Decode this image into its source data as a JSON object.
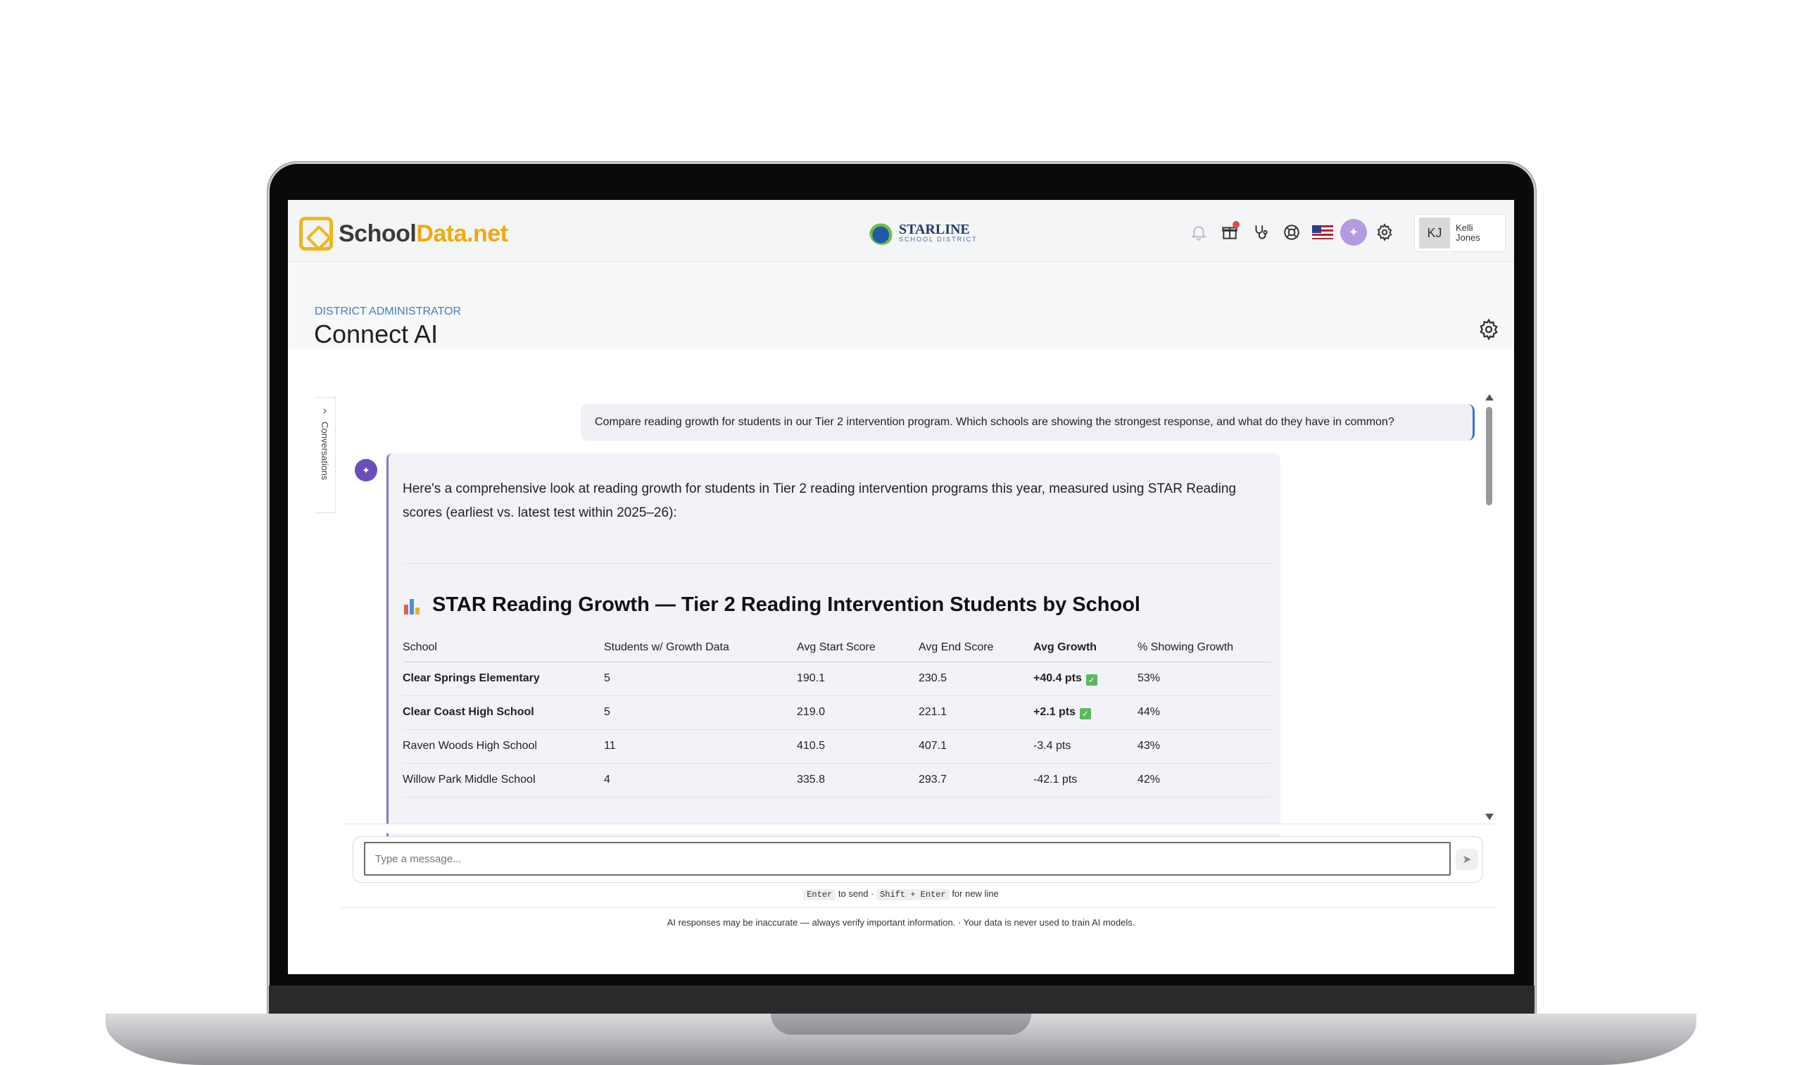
{
  "brand": {
    "name_a": "School",
    "name_b": "Data.net"
  },
  "district": {
    "name": "STARLINE",
    "sub": "SCHOOL DISTRICT"
  },
  "header_icons": [
    "bell-icon",
    "gift-icon",
    "stethoscope-icon",
    "help-lifebuoy-icon",
    "us-flag-icon",
    "ai-sparkle-icon",
    "gear-icon"
  ],
  "user": {
    "initials": "KJ",
    "first": "Kelli",
    "last": "Jones"
  },
  "page": {
    "role": "DISTRICT ADMINISTRATOR",
    "title": "Connect AI"
  },
  "sidebar": {
    "conversations_label": "Conversations"
  },
  "chat": {
    "user_message": "Compare reading growth for students in our Tier 2 intervention program. Which schools are showing the strongest response, and what do they have in common?",
    "ai_intro": "Here's a comprehensive look at reading growth for students in Tier 2 reading intervention programs this year, measured using STAR Reading scores (earliest vs. latest test within 2025–26):",
    "ai_heading": "STAR Reading Growth — Tier 2 Reading Intervention Students by School",
    "table": {
      "headers": [
        "School",
        "Students w/ Growth Data",
        "Avg Start Score",
        "Avg End Score",
        "Avg Growth",
        "% Showing Growth"
      ],
      "rows": [
        {
          "school": "Clear Springs Elementary",
          "students": "5",
          "start": "190.1",
          "end": "230.5",
          "growth": "+40.4 pts",
          "pct": "53%",
          "highlight": true
        },
        {
          "school": "Clear Coast High School",
          "students": "5",
          "start": "219.0",
          "end": "221.1",
          "growth": "+2.1 pts",
          "pct": "44%",
          "highlight": true
        },
        {
          "school": "Raven Woods High School",
          "students": "11",
          "start": "410.5",
          "end": "407.1",
          "growth": "-3.4 pts",
          "pct": "43%",
          "highlight": false
        },
        {
          "school": "Willow Park Middle School",
          "students": "4",
          "start": "335.8",
          "end": "293.7",
          "growth": "-42.1 pts",
          "pct": "42%",
          "highlight": false
        }
      ]
    }
  },
  "composer": {
    "placeholder": "Type a message...",
    "hint_enter": "Enter",
    "hint_send": "to send ·",
    "hint_shift": "Shift + Enter",
    "hint_newline": "for new line"
  },
  "footer": "AI responses may be inaccurate — always verify important information. · Your data is never used to train AI models.",
  "colors": {
    "brand_yellow": "#f0b51a",
    "ai_purple": "#6b4fb8",
    "accent_blue": "#3a6fd1",
    "check_green": "#5cb85c"
  }
}
